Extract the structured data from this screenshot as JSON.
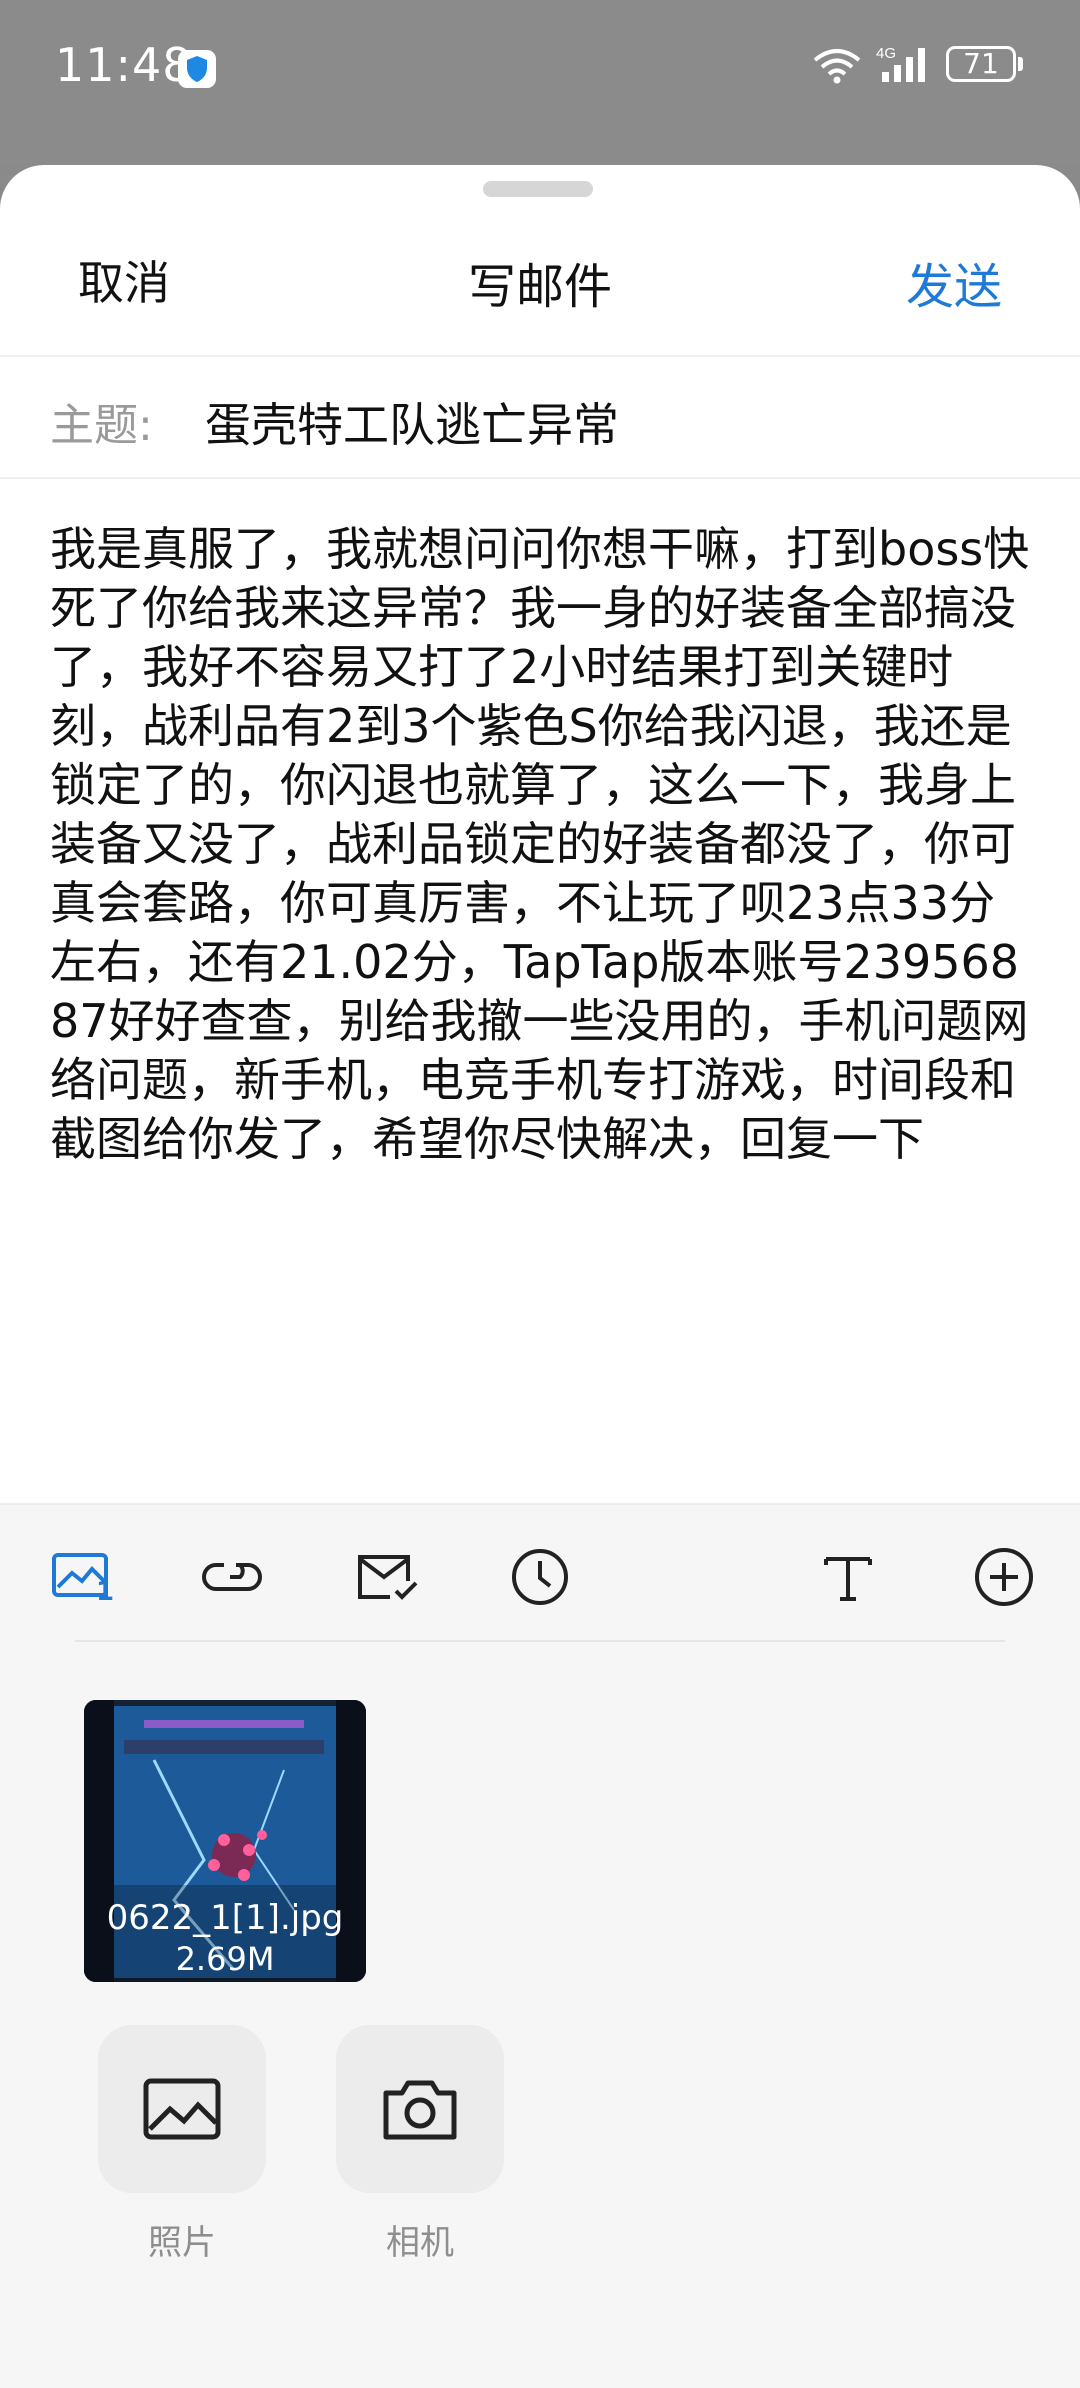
{
  "status_bar": {
    "time": "11:48",
    "network_label": "4G",
    "battery_level": "71",
    "icons": [
      "shield-icon",
      "wifi-icon",
      "signal-icon",
      "battery-icon"
    ]
  },
  "header": {
    "cancel_label": "取消",
    "title": "写邮件",
    "send_label": "发送"
  },
  "subject": {
    "label": "主题:",
    "value": "蛋壳特工队逃亡异常"
  },
  "body": {
    "text": "我是真服了，我就想问问你想干嘛，打到boss快死了你给我来这异常？我一身的好装备全部搞没了，我好不容易又打了2小时结果打到关键时刻，战利品有2到3个紫色S你给我闪退，我还是锁定了的，你闪退也就算了，这么一下，我身上装备又没了，战利品锁定的好装备都没了，你可真会套路，你可真厉害，不让玩了呗23点33分左右，还有21.02分，TapTap版本账号23956887好好查查，别给我撤一些没用的，手机问题网络问题，新手机，电竞手机专打游戏，时间段和截图给你发了，希望你尽快解决，回复一下"
  },
  "toolbar": {
    "image_count": "1",
    "icons": [
      "image-icon",
      "link-icon",
      "mail-check-icon",
      "clock-icon",
      "text-format-icon",
      "add-icon"
    ]
  },
  "attachment": {
    "name": "0622_1[1].jpg",
    "size": "2.69M"
  },
  "pickers": {
    "photo_label": "照片",
    "camera_label": "相机"
  },
  "colors": {
    "accent": "#1e7ad6",
    "status_bar_bg": "#8b8b8b",
    "panel_bg": "#f6f6f6"
  }
}
